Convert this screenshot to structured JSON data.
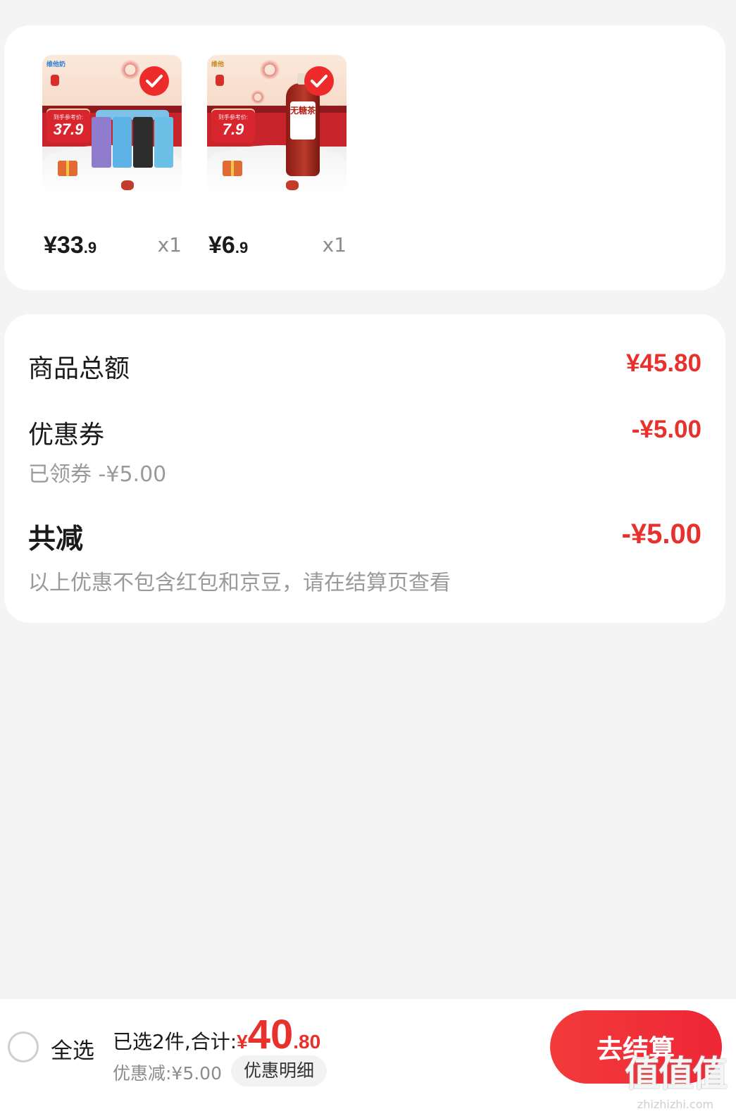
{
  "colors": {
    "accent": "#e8312c",
    "background": "#f4f4f4",
    "card": "#ffffff"
  },
  "products": [
    {
      "brand_mark": "维他奶",
      "tag_caption": "到手参考价:",
      "tag_price": "37.9",
      "price_symbol": "¥",
      "price_int": "33",
      "price_dec": ".9",
      "qty": "x1",
      "selected": true,
      "icon": "checkmark-icon"
    },
    {
      "brand_mark": "维他",
      "tag_caption": "到手参考价:",
      "tag_price": "7.9",
      "label_text": "无糖茶",
      "price_symbol": "¥",
      "price_int": "6",
      "price_dec": ".9",
      "qty": "x1",
      "selected": true,
      "icon": "checkmark-icon"
    }
  ],
  "summary": {
    "goods_total_label": "商品总额",
    "goods_total_value": "¥45.80",
    "coupon_label": "优惠券",
    "coupon_value": "-¥5.00",
    "coupon_sub": "已领券 -¥5.00",
    "total_reduce_label": "共减",
    "total_reduce_value": "-¥5.00",
    "note": "以上优惠不包含红包和京豆，请在结算页查看"
  },
  "bottom_bar": {
    "select_all_label": "全选",
    "selected_text": "已选2件,合计:",
    "total_yen": "¥",
    "total_int": "40",
    "total_dec": ".80",
    "discount_text": "优惠减:¥5.00",
    "detail_button": "优惠明细",
    "checkout_button": "去结算"
  },
  "watermark": {
    "mark": "值值值",
    "url": "zhizhizhi.com"
  }
}
